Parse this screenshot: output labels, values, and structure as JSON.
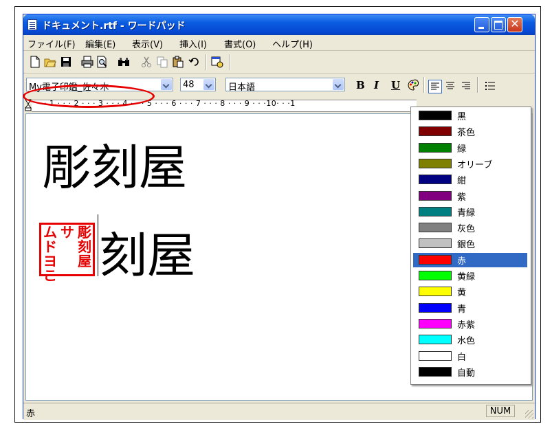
{
  "window": {
    "title": "ドキュメント.rtf - ワードパッド"
  },
  "menu": [
    "ファイル(F)",
    "編集(E)",
    "表示(V)",
    "挿入(I)",
    "書式(O)",
    "ヘルプ(H)"
  ],
  "toolbar": {
    "icons": [
      "new-icon",
      "open-icon",
      "save-icon",
      "print-icon",
      "print-preview-icon",
      "find-icon",
      "cut-icon",
      "copy-icon",
      "paste-icon",
      "undo-icon",
      "insert-date-icon"
    ]
  },
  "format": {
    "font": "My電子印鑑_佐々木",
    "size": "48",
    "script": "日本語",
    "bold": "B",
    "italic": "I",
    "underline": "U"
  },
  "ruler": {
    "marks": "· · 1 · · · 2 · · · 3 · · · 4 · · · 5 · · · 6 · · · 7 · · · 8 · · · 9 · · ·10· · ·1"
  },
  "document": {
    "line1": "彫刻屋",
    "line2": "刻屋",
    "stamp_columns": [
      "ムドヨこ",
      "サ",
      "彫刻屋"
    ]
  },
  "color_menu": {
    "selected": "赤",
    "items": [
      {
        "label": "黒",
        "color": "#000000"
      },
      {
        "label": "茶色",
        "color": "#800000"
      },
      {
        "label": "緑",
        "color": "#008000"
      },
      {
        "label": "オリーブ",
        "color": "#808000"
      },
      {
        "label": "紺",
        "color": "#000080"
      },
      {
        "label": "紫",
        "color": "#800080"
      },
      {
        "label": "青緑",
        "color": "#008080"
      },
      {
        "label": "灰色",
        "color": "#808080"
      },
      {
        "label": "銀色",
        "color": "#c0c0c0"
      },
      {
        "label": "赤",
        "color": "#ff0000"
      },
      {
        "label": "黄緑",
        "color": "#00ff00"
      },
      {
        "label": "黄",
        "color": "#ffff00"
      },
      {
        "label": "青",
        "color": "#0000ff"
      },
      {
        "label": "赤紫",
        "color": "#ff00ff"
      },
      {
        "label": "水色",
        "color": "#00ffff"
      },
      {
        "label": "白",
        "color": "#ffffff"
      },
      {
        "label": "自動",
        "color": "#000000"
      }
    ]
  },
  "status": {
    "text": "赤",
    "num": "NUM"
  }
}
